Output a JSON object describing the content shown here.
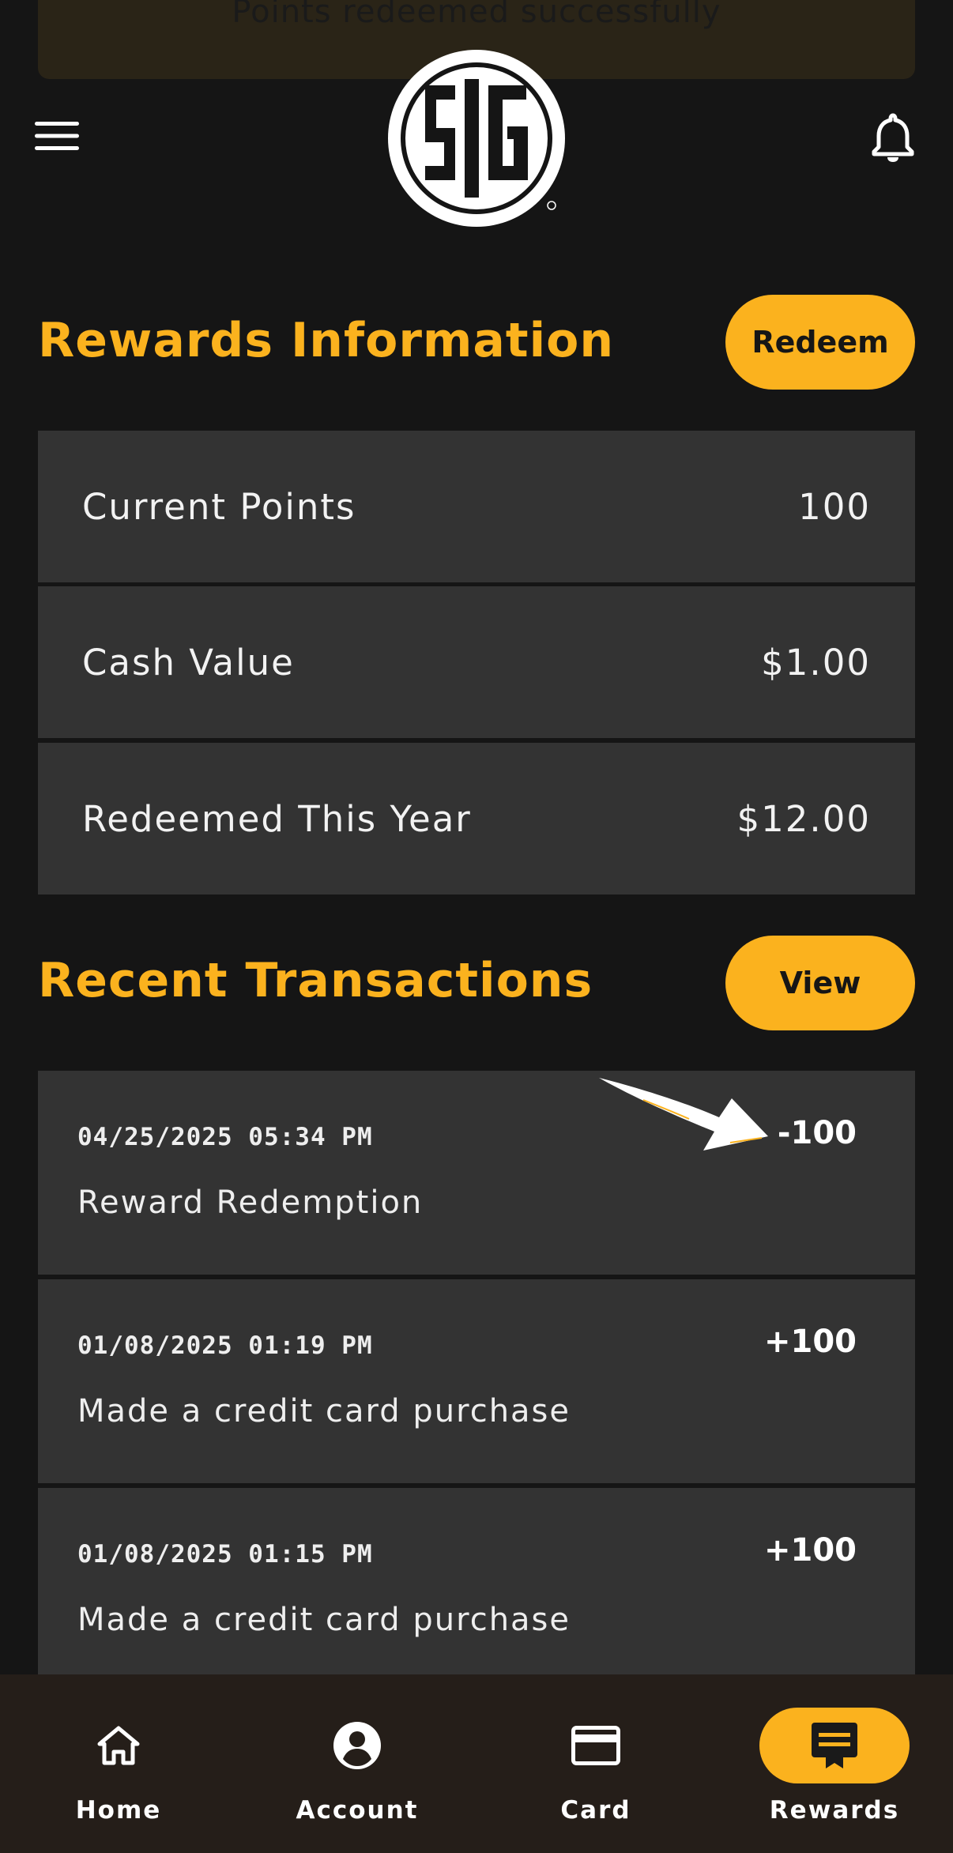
{
  "toast": {
    "message": "Points redeemed successfully"
  },
  "header": {
    "logo_text": "SIG",
    "menu_icon": "hamburger-menu-icon",
    "notifications_icon": "bell-icon"
  },
  "rewards": {
    "title": "Rewards Information",
    "redeem_label": "Redeem",
    "rows": [
      {
        "label": "Current Points",
        "value": "100"
      },
      {
        "label": "Cash Value",
        "value": "$1.00"
      },
      {
        "label": "Redeemed This Year",
        "value": "$12.00"
      }
    ]
  },
  "transactions": {
    "title": "Recent Transactions",
    "view_label": "View",
    "items": [
      {
        "date": "04/25/2025 05:34 PM",
        "description": "Reward Redemption",
        "amount": "-100"
      },
      {
        "date": "01/08/2025 01:19 PM",
        "description": "Made a credit card purchase",
        "amount": "+100"
      },
      {
        "date": "01/08/2025 01:15 PM",
        "description": "Made a credit card purchase",
        "amount": "+100"
      }
    ]
  },
  "nav": {
    "items": [
      {
        "label": "Home",
        "icon": "home-icon"
      },
      {
        "label": "Account",
        "icon": "account-icon"
      },
      {
        "label": "Card",
        "icon": "credit-card-icon"
      },
      {
        "label": "Rewards",
        "icon": "rewards-icon",
        "active": true
      }
    ]
  },
  "colors": {
    "accent": "#fbb21e",
    "background": "#151515",
    "row_background": "#333333",
    "nav_background": "#251e19"
  }
}
